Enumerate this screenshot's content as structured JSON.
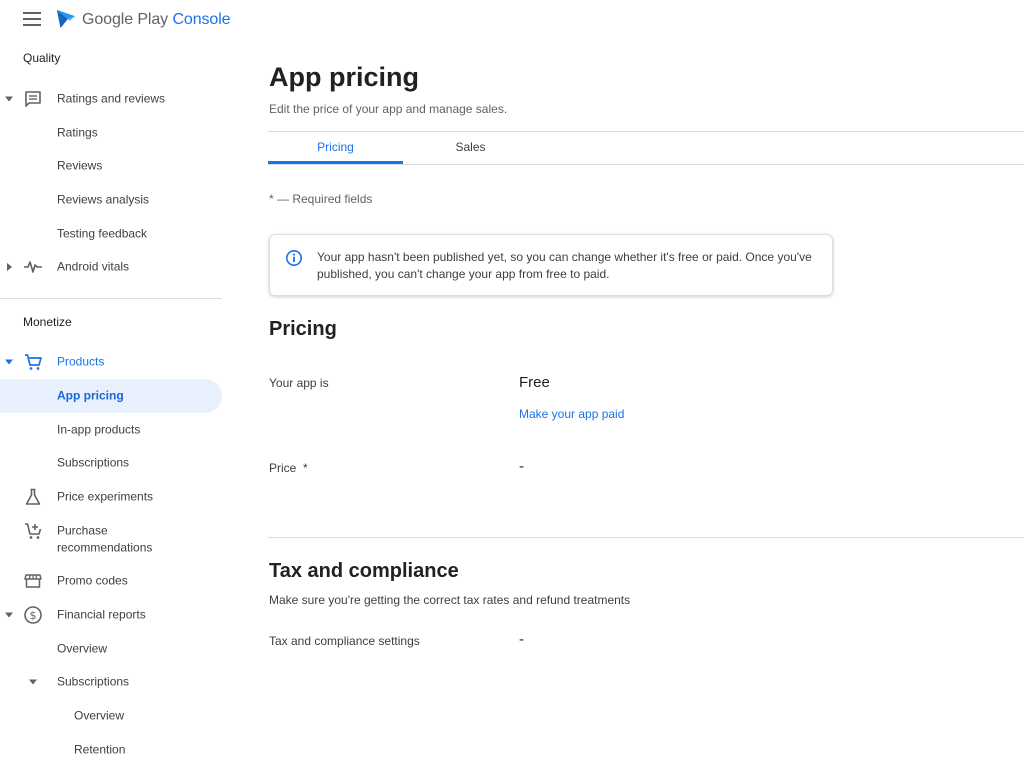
{
  "app": {
    "brand_primary": "Google Play",
    "brand_secondary": "Console"
  },
  "sidebar": {
    "quality_title": "Quality",
    "monetize_title": "Monetize",
    "items": {
      "ratings_and_reviews": "Ratings and reviews",
      "ratings": "Ratings",
      "reviews": "Reviews",
      "reviews_analysis": "Reviews analysis",
      "testing_feedback": "Testing feedback",
      "android_vitals": "Android vitals",
      "products": "Products",
      "app_pricing": "App pricing",
      "in_app_products": "In-app products",
      "subscriptions": "Subscriptions",
      "price_experiments": "Price experiments",
      "purchase_recommendations_1": "Purchase",
      "purchase_recommendations_2": "recommendations",
      "promo_codes": "Promo codes",
      "financial_reports": "Financial reports",
      "overview": "Overview",
      "fr_subscriptions": "Subscriptions",
      "sub_overview": "Overview",
      "retention": "Retention"
    }
  },
  "main": {
    "title": "App pricing",
    "subtitle": "Edit the price of your app and manage sales.",
    "tabs": [
      "Pricing",
      "Sales"
    ],
    "required_note": "* — Required fields",
    "info_text": "Your app hasn't been published yet, so you can change whether it's free or paid. Once you've published, you can't change your app from free to paid.",
    "pricing": {
      "heading": "Pricing",
      "your_app_is_label": "Your app is",
      "your_app_is_value": "Free",
      "make_paid_link": "Make your app paid",
      "price_label": "Price  *",
      "price_value": "-"
    },
    "tax": {
      "heading": "Tax and compliance",
      "description": "Make sure you're getting the correct tax rates and refund treatments",
      "settings_label": "Tax and compliance settings",
      "settings_value": "-"
    }
  },
  "colors": {
    "accent": "#1a73e8",
    "selected_bg": "#e8f0fe",
    "divider": "#dadce0"
  }
}
